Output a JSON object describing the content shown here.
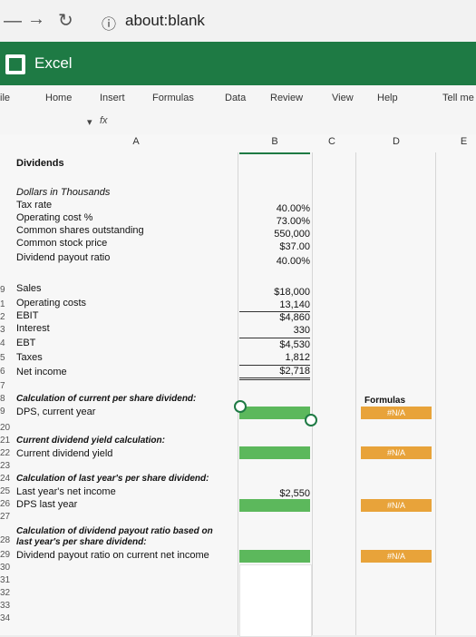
{
  "browser": {
    "url": "about:blank"
  },
  "app": {
    "name": "Excel"
  },
  "ribbon_tabs": [
    "ile",
    "Home",
    "Insert",
    "Formulas",
    "Data",
    "Review",
    "View",
    "Help",
    "Tell me"
  ],
  "formula_bar": {
    "fx": "fx"
  },
  "columns": [
    "A",
    "B",
    "C",
    "D",
    "E"
  ],
  "sheet": {
    "title": "Dividends",
    "section1": {
      "header": "Dollars in Thousands",
      "rows": [
        {
          "label": "Tax rate",
          "value": "40.00%"
        },
        {
          "label": "Operating cost %",
          "value": "73.00%"
        },
        {
          "label": "Common shares outstanding",
          "value": "550,000"
        },
        {
          "label": "Common stock price",
          "value": "$37.00"
        },
        {
          "label": "Dividend payout ratio",
          "value": "40.00%"
        }
      ]
    },
    "income": [
      {
        "num": "9",
        "label": "Sales",
        "value": "$18,000"
      },
      {
        "num": "1",
        "label": "Operating costs",
        "value": "13,140"
      },
      {
        "num": "2",
        "label": "EBIT",
        "value": "$4,860"
      },
      {
        "num": "3",
        "label": "Interest",
        "value": "330"
      },
      {
        "num": "4",
        "label": "EBT",
        "value": "$4,530"
      },
      {
        "num": "5",
        "label": "Taxes",
        "value": "1,812"
      },
      {
        "num": "6",
        "label": "Net income",
        "value": "$2,718"
      }
    ],
    "calc": {
      "r18": "Calculation of current per share dividend:",
      "r19": "DPS, current year",
      "r21": "Current dividend yield calculation:",
      "r22": "Current dividend yield",
      "r24": "Calculation of last year's per share dividend:",
      "r25": "Last year's net income",
      "r25_value": "$2,550",
      "r26": "DPS last year",
      "r28a": "Calculation of dividend payout ratio based on",
      "r28b": "last year's per share dividend:",
      "r29": "Dividend payout ratio on current net income"
    },
    "formulas_header": "Formulas",
    "na": "#N/A"
  },
  "row_numbers": [
    "7",
    "8",
    "9",
    "20",
    "21",
    "22",
    "23",
    "24",
    "25",
    "26",
    "27",
    "28",
    "29",
    "30",
    "31",
    "32",
    "33",
    "34"
  ]
}
